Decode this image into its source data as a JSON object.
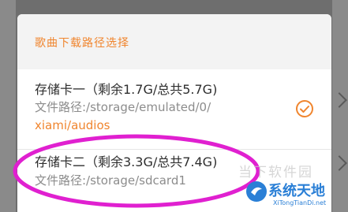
{
  "dialog": {
    "title": "歌曲下载路径选择",
    "options": [
      {
        "name": "存储卡一（剩余1.7G/总共5.7G)",
        "path_line1": "文件路径:/storage/emulated/0/",
        "path_line2": "xiami/audios",
        "selected": true,
        "check_icon": "check-circle-icon"
      },
      {
        "name": "存储卡二（剩余3.3G/总共7.4G)",
        "path_line1": "文件路径:/storage/sdcard1",
        "selected": false
      }
    ]
  },
  "watermark": {
    "text": "当下软件园",
    "brand": "系统天地",
    "url": "XiTongTianDi.net"
  },
  "colors": {
    "accent": "#f0852e",
    "highlight": "#e020d0",
    "overlay": "#6e6e6e"
  }
}
